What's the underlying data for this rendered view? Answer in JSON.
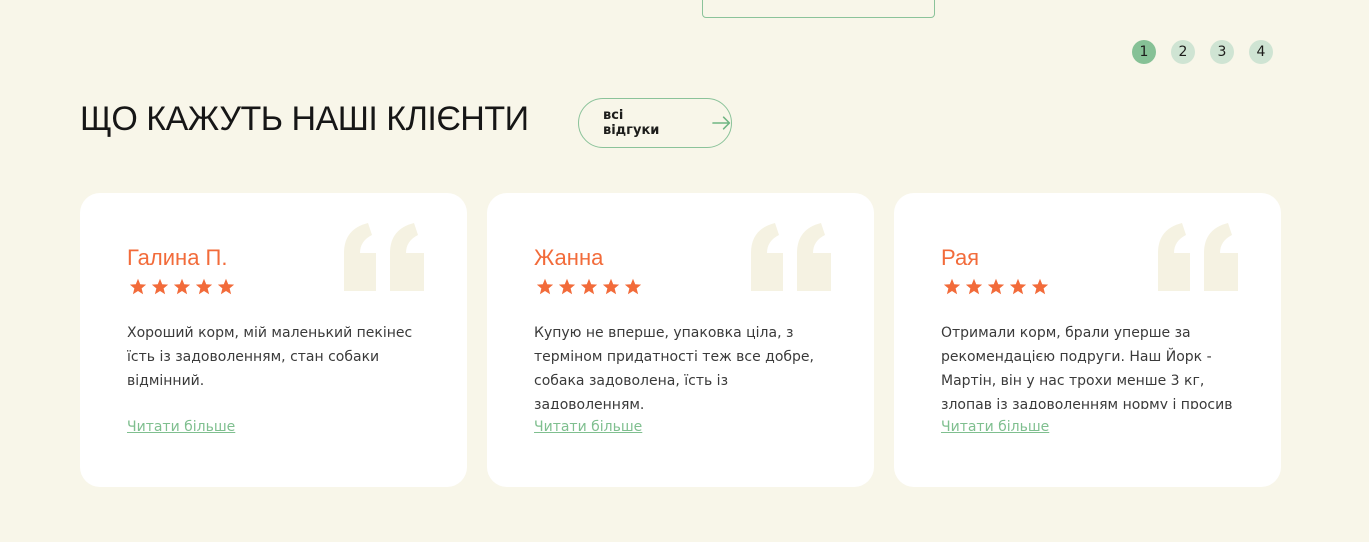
{
  "pagination": {
    "pages": [
      "1",
      "2",
      "3",
      "4"
    ],
    "active": "1"
  },
  "section": {
    "title": "ЩО КАЖУТЬ НАШІ КЛІЄНТИ",
    "all_reviews_label": "всі відгуки"
  },
  "colors": {
    "background": "#f8f6e9",
    "accent_orange": "#f26b3a",
    "accent_green": "#86c196",
    "quote_mark": "#f5f2e2"
  },
  "icons": {
    "arrow": "arrow-right-icon",
    "star": "star-icon",
    "quote": "quote-icon"
  },
  "reviews": [
    {
      "name": "Галина П.",
      "rating": 5,
      "text": "Хороший корм, мій маленький пекінес їсть із задоволенням, стан собаки відмінний.",
      "read_more": "Читати більше"
    },
    {
      "name": "Жанна",
      "rating": 5,
      "text": "Купую не вперше, упаковка ціла, з терміном придатності теж все добре, собака задоволена, їсть із задоволенням.",
      "read_more": "Читати більше"
    },
    {
      "name": "Рая",
      "rating": 5,
      "text": "Отримали корм, брали уперше за рекомендацією подруги. Наш Йорк - Мартін, він у нас трохи менше 3 кг, злопав із задоволенням норму і просив",
      "read_more": "Читати більше"
    }
  ]
}
